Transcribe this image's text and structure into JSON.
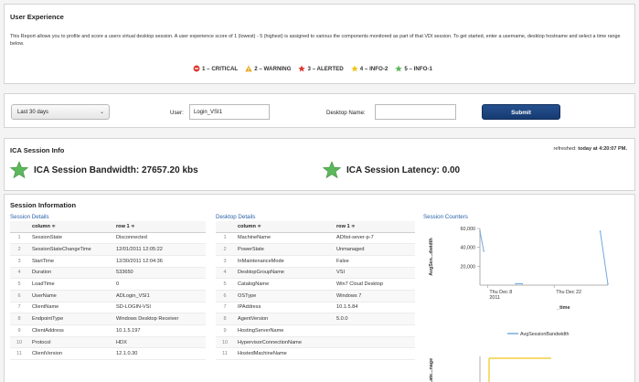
{
  "header": {
    "title": "User Experience",
    "description": "This Report allows you to profile and score a users virtual desktop session. A user experience score of 1 (lowest) - 5 (highest) is assigned to various the components monitored as part of that VDI session. To get started, enter a username, desktop hostname and select a time range below.",
    "legend": [
      {
        "label": "1 – CRITICAL",
        "icon": "critical-icon",
        "color": "#d9352b"
      },
      {
        "label": "2 – WARNING",
        "icon": "warning-icon",
        "color": "#e8a81f"
      },
      {
        "label": "3 – ALERTED",
        "icon": "alerted-star-icon",
        "color": "#d9352b"
      },
      {
        "label": "4 – INFO-2",
        "icon": "info2-star-icon",
        "color": "#f0c419"
      },
      {
        "label": "5 – INFO-1",
        "icon": "info1-star-icon",
        "color": "#5cb85c"
      }
    ]
  },
  "filters": {
    "time_range": "Last 30 days",
    "user_label": "User:",
    "user_value": "Login_VSI1",
    "desktop_label": "Desktop Name:",
    "desktop_value": "",
    "submit_label": "Submit"
  },
  "ica": {
    "title": "ICA Session Info",
    "refreshed_label": "refreshed:",
    "refreshed_value": "today at 4:20:07 PM.",
    "bandwidth_label": "ICA Session Bandwidth: 27657.20 kbs",
    "latency_label": "ICA Session Latency: 0.00",
    "star_color": "#5cb85c"
  },
  "session": {
    "title": "Session Information",
    "details_title": "Session Details",
    "desktop_title": "Desktop Details",
    "counters_title": "Session Counters",
    "col_column": "column",
    "col_row1": "row 1",
    "sort_glyph": "≑",
    "details_rows": [
      [
        "1",
        "SessionState",
        "Disconnected"
      ],
      [
        "2",
        "SessionStateChangeTime",
        "12/01/2011 12:05:22"
      ],
      [
        "3",
        "StartTime",
        "12/30/2011 12:04:36"
      ],
      [
        "4",
        "Duration",
        "533650"
      ],
      [
        "5",
        "LoadTime",
        "0"
      ],
      [
        "6",
        "UserName",
        "ADLogin_VSI1"
      ],
      [
        "7",
        "ClientName",
        "SD-LOGIN-VSI"
      ],
      [
        "8",
        "EndpointType",
        "Windows Desktop Receiver"
      ],
      [
        "9",
        "ClientAddress",
        "10.1.5.197"
      ],
      [
        "10",
        "Protocol",
        "HDX"
      ],
      [
        "11",
        "ClientVersion",
        "12.1.0.30"
      ]
    ],
    "desktop_rows": [
      [
        "1",
        "MachineName",
        "ADItst-sever-p-7"
      ],
      [
        "2",
        "PowerState",
        "Unmanaged"
      ],
      [
        "3",
        "InMaintenanceMode",
        "False"
      ],
      [
        "4",
        "DesktopGroupName",
        "VSI"
      ],
      [
        "5",
        "CatalogName",
        "Win7 Cloud Desktop"
      ],
      [
        "6",
        "OSType",
        "Windows 7"
      ],
      [
        "7",
        "IPAddress",
        "10.1.5.84"
      ],
      [
        "8",
        "AgentVersion",
        "5.0.0"
      ],
      [
        "9",
        "HostingServerName",
        ""
      ],
      [
        "10",
        "HypervisorConnectionName",
        ""
      ],
      [
        "11",
        "HostedMachineName",
        ""
      ]
    ]
  },
  "chart_data": [
    {
      "type": "line",
      "title": "",
      "xlabel": "_time",
      "ylabel": "AvgSes...dwidth",
      "ylim": [
        0,
        60000
      ],
      "yticks": [
        "60,000",
        "40,000",
        "20,000"
      ],
      "xticks": [
        "Thu Dec 8\n2011",
        "Thu Dec 22"
      ],
      "grid": false,
      "legend_position": "bottom",
      "series": [
        {
          "name": "AvgSessionBandwidth",
          "color": "#6fa8dc",
          "points": [
            [
              0.0,
              57000
            ],
            [
              0.03,
              36000
            ],
            [
              0.28,
              1500
            ],
            [
              0.33,
              1500
            ],
            [
              0.94,
              57000
            ],
            [
              1.0,
              1000
            ]
          ]
        }
      ]
    },
    {
      "type": "line",
      "title": "",
      "ylabel": "Late...nage",
      "series": [
        {
          "name": "",
          "color": "#f0c419",
          "points": []
        }
      ]
    }
  ]
}
